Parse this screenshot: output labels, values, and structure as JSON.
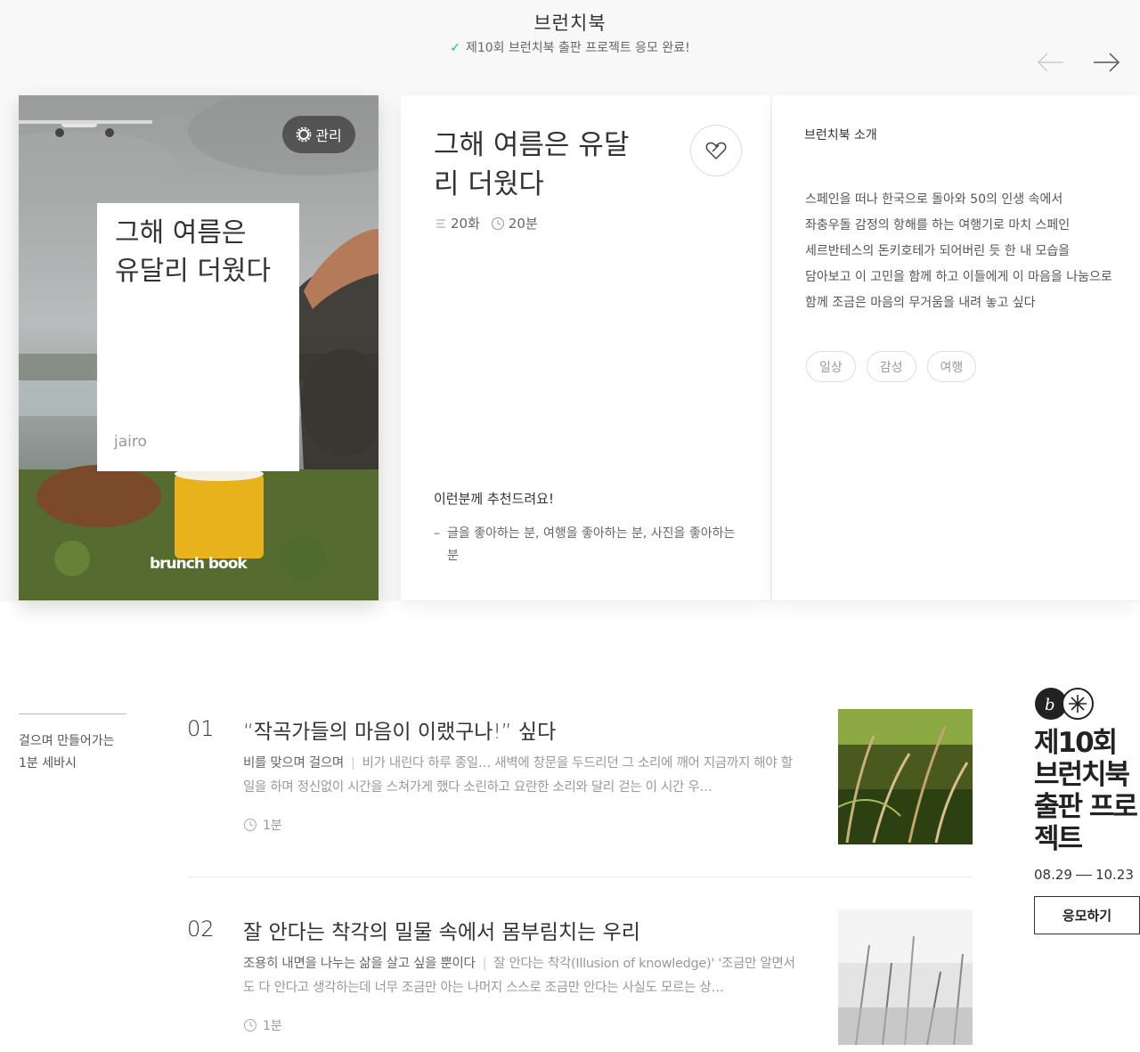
{
  "header": {
    "title": "브런치북",
    "subtitle": "제10회 브런치북 출판 프로젝트 응모 완료!"
  },
  "nav": {
    "prev_icon": "arrow-left-icon",
    "next_icon": "arrow-right-icon"
  },
  "cover": {
    "title": "그해 여름은 유달리 더웠다",
    "author": "jairo",
    "manage_label": "관리",
    "brand": "brunch book"
  },
  "book": {
    "title": "그해 여름은 유달리 더웠다",
    "episodes": "20화",
    "duration": "20분",
    "recommend_label": "이런분께 추천드려요!",
    "recommend_item": "글을 좋아하는 분, 여행을 좋아하는 분, 사진을 좋아하는 분"
  },
  "intro": {
    "label": "브런치북 소개",
    "text": "스페인을 떠나 한국으로 돌아와 50의 인생 속에서 좌충우돌 감정의 항해를 하는 여행기로 마치 스페인 세르반테스의 돈키호테가 되어버린 듯 한 내 모습을 담아보고 이 고민을 함께 하고 이들에게 이 마음을 나눔으로 함께 조금은 마음의 무거움을 내려 놓고 싶다",
    "tags": [
      "일상",
      "감성",
      "여행"
    ]
  },
  "sidebar": {
    "text": "걸으며 만들어가는 1분 세바시"
  },
  "articles": [
    {
      "num": "01",
      "title": "“작곡가들의 마음이 이랬구나!” 싶다",
      "subtitle": "비를 맞으며 걸으며",
      "desc": "비가 내린다 하루 종일… 새벽에 창문을 두드리던 그 소리에 깨어 지금까지 해야 할 일을 하며 정신없이 시간을 스쳐가게 했다 소린하고 요란한 소리와 달리 걷는 이 시간 우…",
      "time": "1분"
    },
    {
      "num": "02",
      "title": "잘 안다는 착각의 밀물 속에서 몸부림치는 우리",
      "subtitle": "조용히 내면을 나누는 삶을 살고 싶을 뿐이다",
      "desc": "잘 안다는 착각(Illusion of knowledge)' '조금만 알면서도 다 안다고 생각하는데 너무 조금만 아는 나머지 스스로 조금만 안다는 사실도 모르는 상…",
      "time": "1분"
    }
  ],
  "promo": {
    "title": "제10회 브런치북 출판 프로젝트",
    "date_start": "08.29",
    "date_end": "10.23",
    "button": "응모하기"
  },
  "colors": {
    "accent": "#00c3bd",
    "text": "#333333",
    "muted": "#999999",
    "background": "#f8f8f8"
  }
}
